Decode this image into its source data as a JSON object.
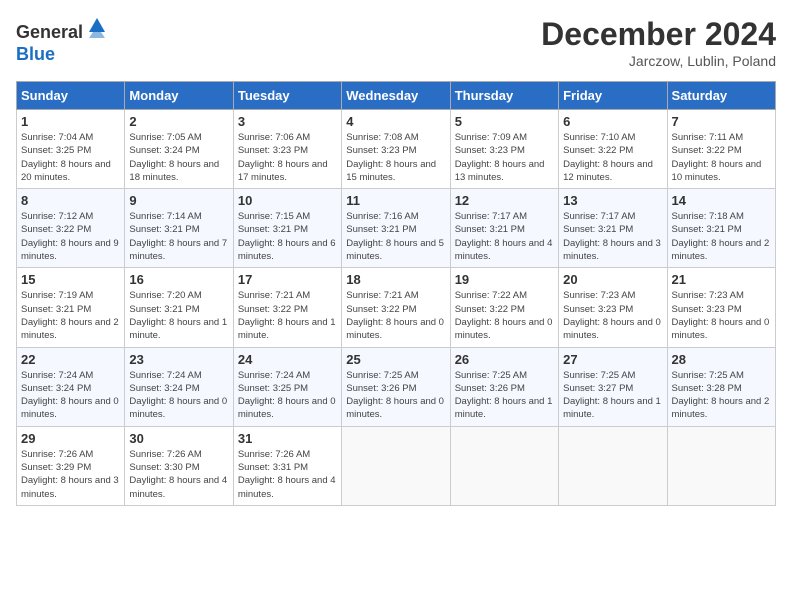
{
  "header": {
    "logo_line1": "General",
    "logo_line2": "Blue",
    "month_year": "December 2024",
    "location": "Jarczow, Lublin, Poland"
  },
  "days_of_week": [
    "Sunday",
    "Monday",
    "Tuesday",
    "Wednesday",
    "Thursday",
    "Friday",
    "Saturday"
  ],
  "weeks": [
    [
      {
        "day": 1,
        "sunrise": "7:04 AM",
        "sunset": "3:25 PM",
        "daylight": "8 hours and 20 minutes."
      },
      {
        "day": 2,
        "sunrise": "7:05 AM",
        "sunset": "3:24 PM",
        "daylight": "8 hours and 18 minutes."
      },
      {
        "day": 3,
        "sunrise": "7:06 AM",
        "sunset": "3:23 PM",
        "daylight": "8 hours and 17 minutes."
      },
      {
        "day": 4,
        "sunrise": "7:08 AM",
        "sunset": "3:23 PM",
        "daylight": "8 hours and 15 minutes."
      },
      {
        "day": 5,
        "sunrise": "7:09 AM",
        "sunset": "3:23 PM",
        "daylight": "8 hours and 13 minutes."
      },
      {
        "day": 6,
        "sunrise": "7:10 AM",
        "sunset": "3:22 PM",
        "daylight": "8 hours and 12 minutes."
      },
      {
        "day": 7,
        "sunrise": "7:11 AM",
        "sunset": "3:22 PM",
        "daylight": "8 hours and 10 minutes."
      }
    ],
    [
      {
        "day": 8,
        "sunrise": "7:12 AM",
        "sunset": "3:22 PM",
        "daylight": "8 hours and 9 minutes."
      },
      {
        "day": 9,
        "sunrise": "7:14 AM",
        "sunset": "3:21 PM",
        "daylight": "8 hours and 7 minutes."
      },
      {
        "day": 10,
        "sunrise": "7:15 AM",
        "sunset": "3:21 PM",
        "daylight": "8 hours and 6 minutes."
      },
      {
        "day": 11,
        "sunrise": "7:16 AM",
        "sunset": "3:21 PM",
        "daylight": "8 hours and 5 minutes."
      },
      {
        "day": 12,
        "sunrise": "7:17 AM",
        "sunset": "3:21 PM",
        "daylight": "8 hours and 4 minutes."
      },
      {
        "day": 13,
        "sunrise": "7:17 AM",
        "sunset": "3:21 PM",
        "daylight": "8 hours and 3 minutes."
      },
      {
        "day": 14,
        "sunrise": "7:18 AM",
        "sunset": "3:21 PM",
        "daylight": "8 hours and 2 minutes."
      }
    ],
    [
      {
        "day": 15,
        "sunrise": "7:19 AM",
        "sunset": "3:21 PM",
        "daylight": "8 hours and 2 minutes."
      },
      {
        "day": 16,
        "sunrise": "7:20 AM",
        "sunset": "3:21 PM",
        "daylight": "8 hours and 1 minute."
      },
      {
        "day": 17,
        "sunrise": "7:21 AM",
        "sunset": "3:22 PM",
        "daylight": "8 hours and 1 minute."
      },
      {
        "day": 18,
        "sunrise": "7:21 AM",
        "sunset": "3:22 PM",
        "daylight": "8 hours and 0 minutes."
      },
      {
        "day": 19,
        "sunrise": "7:22 AM",
        "sunset": "3:22 PM",
        "daylight": "8 hours and 0 minutes."
      },
      {
        "day": 20,
        "sunrise": "7:23 AM",
        "sunset": "3:23 PM",
        "daylight": "8 hours and 0 minutes."
      },
      {
        "day": 21,
        "sunrise": "7:23 AM",
        "sunset": "3:23 PM",
        "daylight": "8 hours and 0 minutes."
      }
    ],
    [
      {
        "day": 22,
        "sunrise": "7:24 AM",
        "sunset": "3:24 PM",
        "daylight": "8 hours and 0 minutes."
      },
      {
        "day": 23,
        "sunrise": "7:24 AM",
        "sunset": "3:24 PM",
        "daylight": "8 hours and 0 minutes."
      },
      {
        "day": 24,
        "sunrise": "7:24 AM",
        "sunset": "3:25 PM",
        "daylight": "8 hours and 0 minutes."
      },
      {
        "day": 25,
        "sunrise": "7:25 AM",
        "sunset": "3:26 PM",
        "daylight": "8 hours and 0 minutes."
      },
      {
        "day": 26,
        "sunrise": "7:25 AM",
        "sunset": "3:26 PM",
        "daylight": "8 hours and 1 minute."
      },
      {
        "day": 27,
        "sunrise": "7:25 AM",
        "sunset": "3:27 PM",
        "daylight": "8 hours and 1 minute."
      },
      {
        "day": 28,
        "sunrise": "7:25 AM",
        "sunset": "3:28 PM",
        "daylight": "8 hours and 2 minutes."
      }
    ],
    [
      {
        "day": 29,
        "sunrise": "7:26 AM",
        "sunset": "3:29 PM",
        "daylight": "8 hours and 3 minutes."
      },
      {
        "day": 30,
        "sunrise": "7:26 AM",
        "sunset": "3:30 PM",
        "daylight": "8 hours and 4 minutes."
      },
      {
        "day": 31,
        "sunrise": "7:26 AM",
        "sunset": "3:31 PM",
        "daylight": "8 hours and 4 minutes."
      },
      null,
      null,
      null,
      null
    ]
  ]
}
